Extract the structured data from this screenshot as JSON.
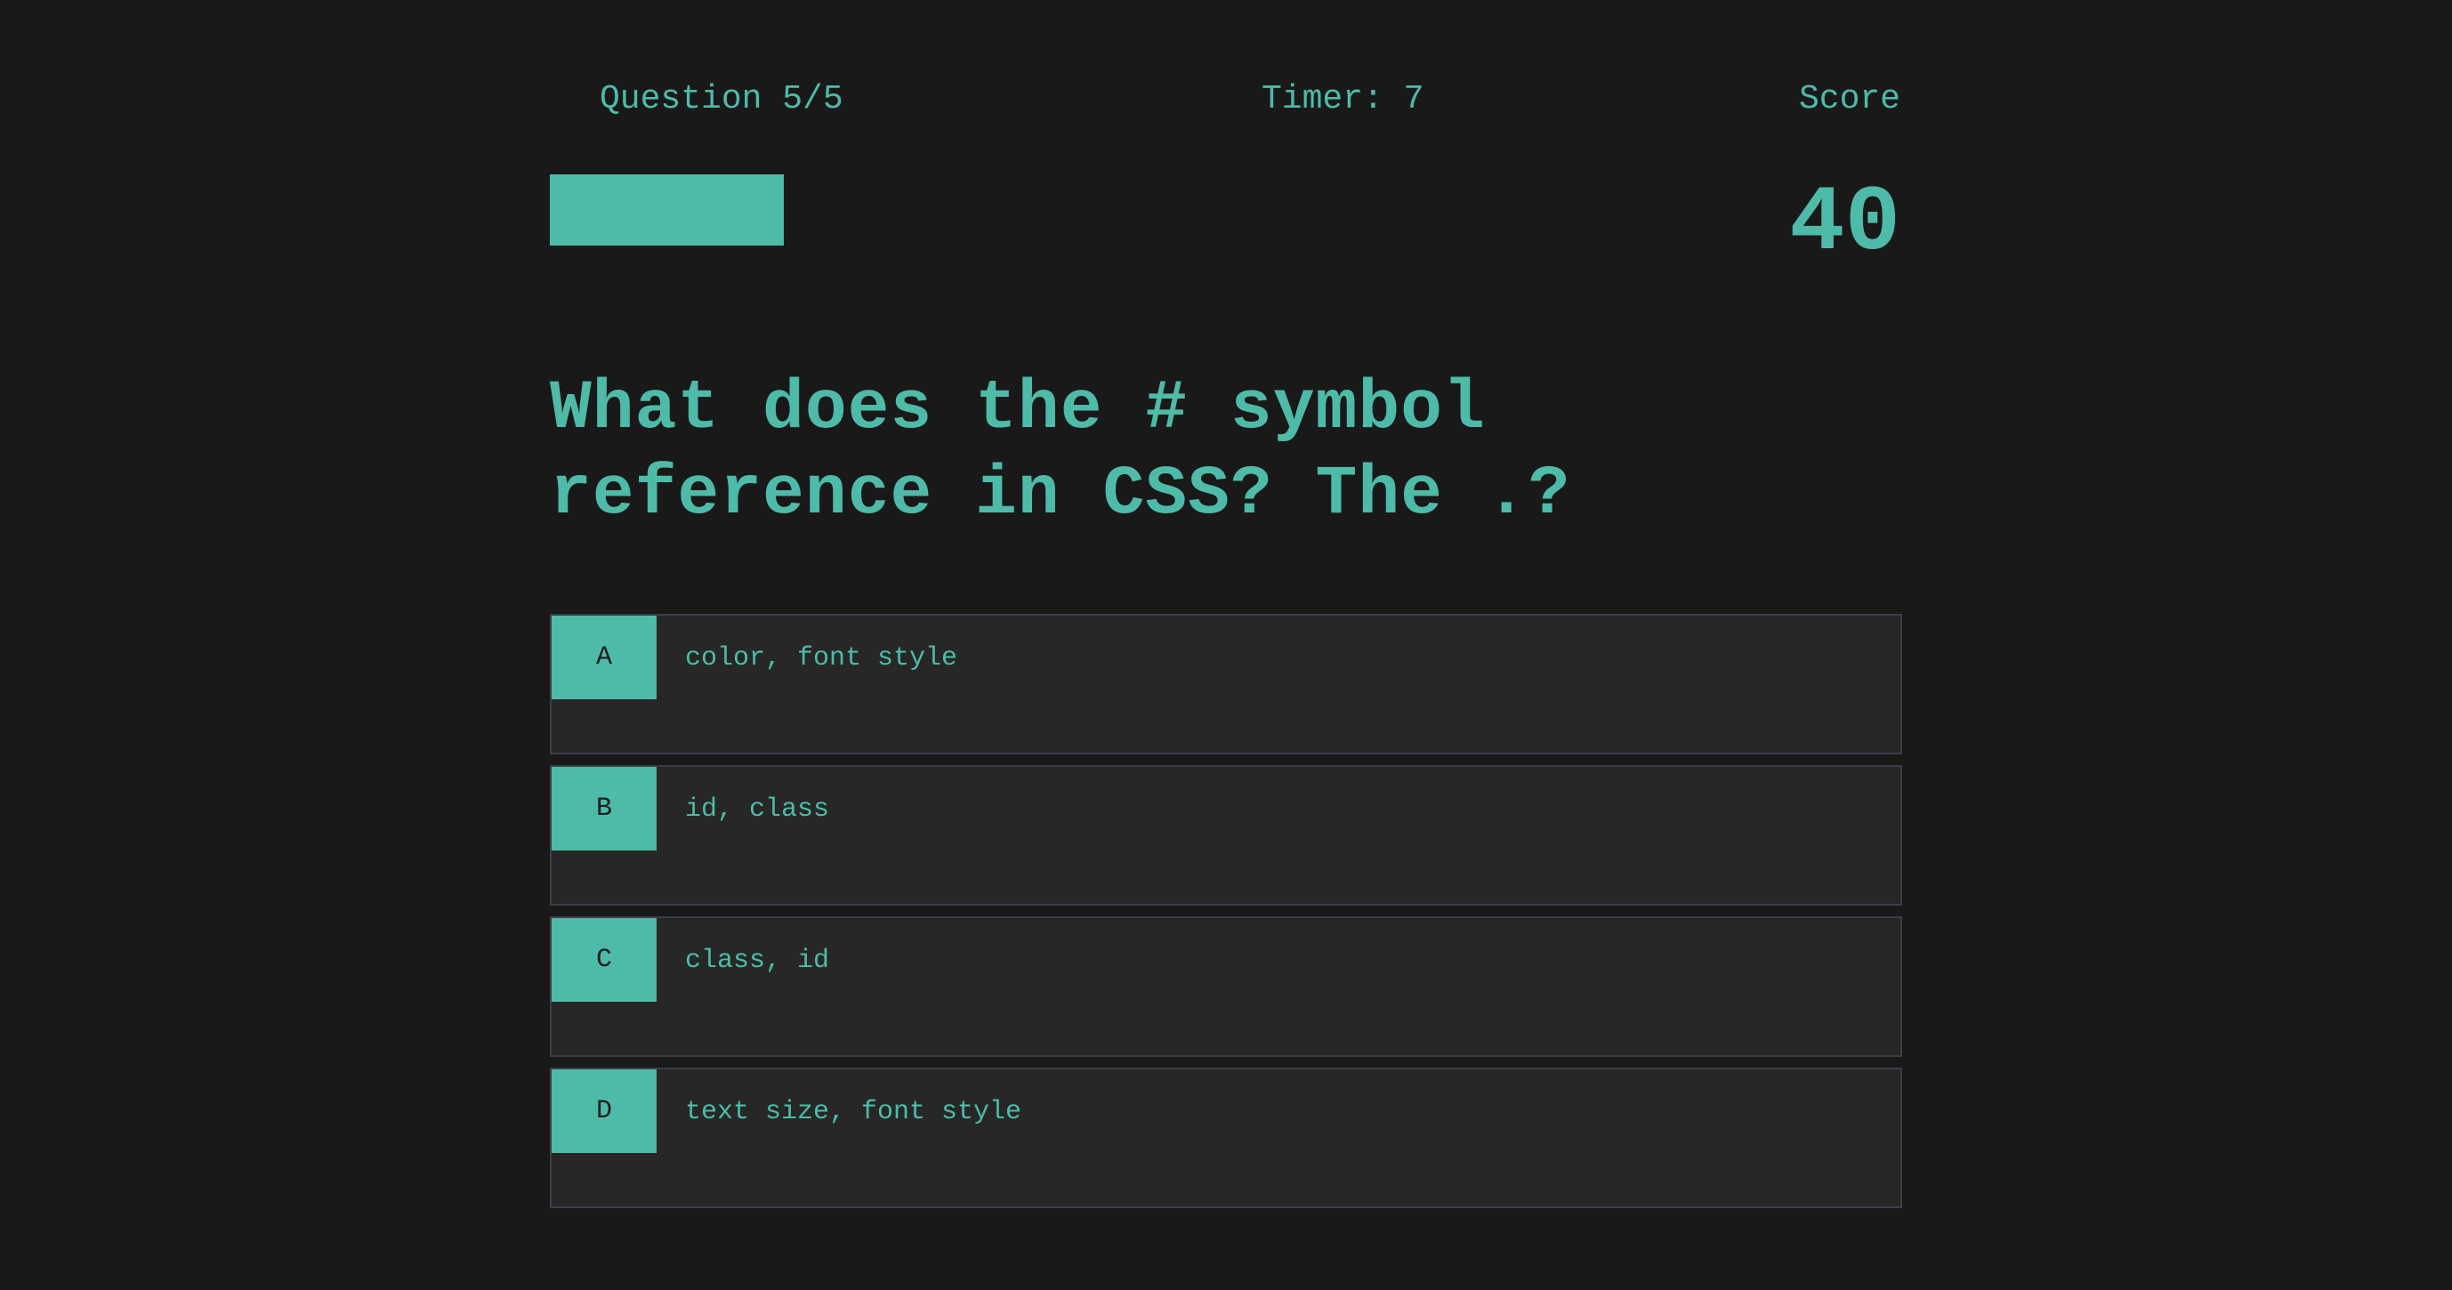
{
  "header": {
    "question_counter": "Question 5/5",
    "timer": "Timer: 7",
    "score_label": "Score",
    "score_value": "40",
    "progress_fraction": 0.2625
  },
  "question": {
    "text": "What does the # symbol reference in CSS? The .?"
  },
  "answers": [
    {
      "key": "A",
      "text": "color, font style"
    },
    {
      "key": "B",
      "text": "id, class"
    },
    {
      "key": "C",
      "text": "class, id"
    },
    {
      "key": "D",
      "text": "text size, font style"
    }
  ],
  "colors": {
    "background": "#191919",
    "accent": "#4dbba8",
    "answer_bg": "#272727",
    "answer_border": "#3a3f47",
    "key_text": "#1e1e1e"
  }
}
